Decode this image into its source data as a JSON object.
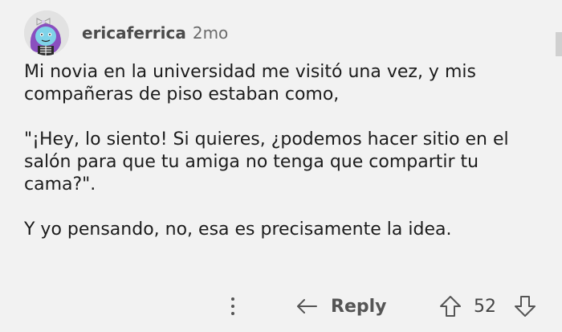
{
  "comment": {
    "username": "ericaferrica",
    "time": "2mo",
    "paragraphs": [
      "Mi novia en la universidad me visitó una vez, y mis compañeras de piso estaban como,",
      "\"¡Hey, lo siento! Si quieres, ¿podemos hacer sitio en el salón para que tu amiga no tenga que compartir tu cama?\".",
      "Y yo pensando, no, esa es precisamente la idea."
    ]
  },
  "actions": {
    "reply_label": "Reply",
    "score": "52"
  },
  "icons": {
    "more": "more-vertical-icon",
    "reply": "reply-arrow-icon",
    "upvote": "upvote-arrow-icon",
    "downvote": "downvote-arrow-icon"
  }
}
